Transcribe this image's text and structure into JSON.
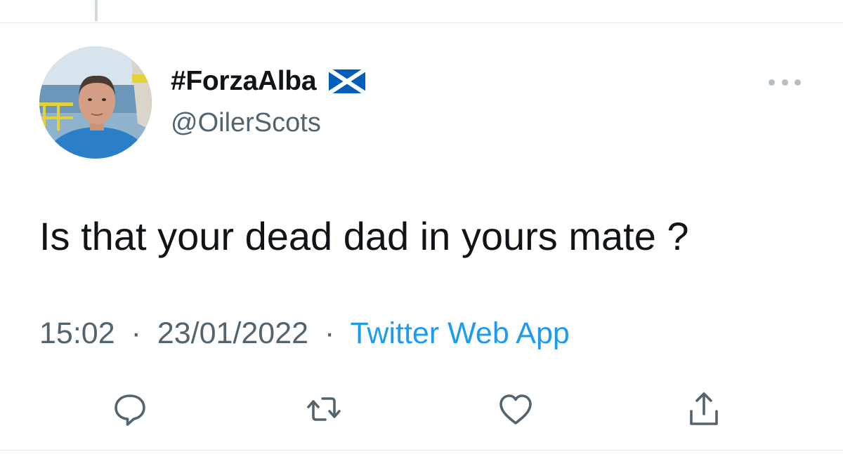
{
  "author": {
    "display_name": "#ForzaAlba",
    "handle": "@OilerScots",
    "flag_icon": "scotland-flag-icon"
  },
  "tweet": {
    "text": "Is that your dead dad in yours mate ?",
    "time": "15:02",
    "date": "23/01/2022",
    "separator": "·",
    "source": "Twitter Web App"
  },
  "actions": {
    "reply_icon": "reply-icon",
    "retweet_icon": "retweet-icon",
    "like_icon": "heart-icon",
    "share_icon": "share-icon"
  },
  "colors": {
    "text_primary": "#0f1419",
    "text_secondary": "#536471",
    "link": "#1d9bf0",
    "flag_blue": "#005EB8"
  }
}
